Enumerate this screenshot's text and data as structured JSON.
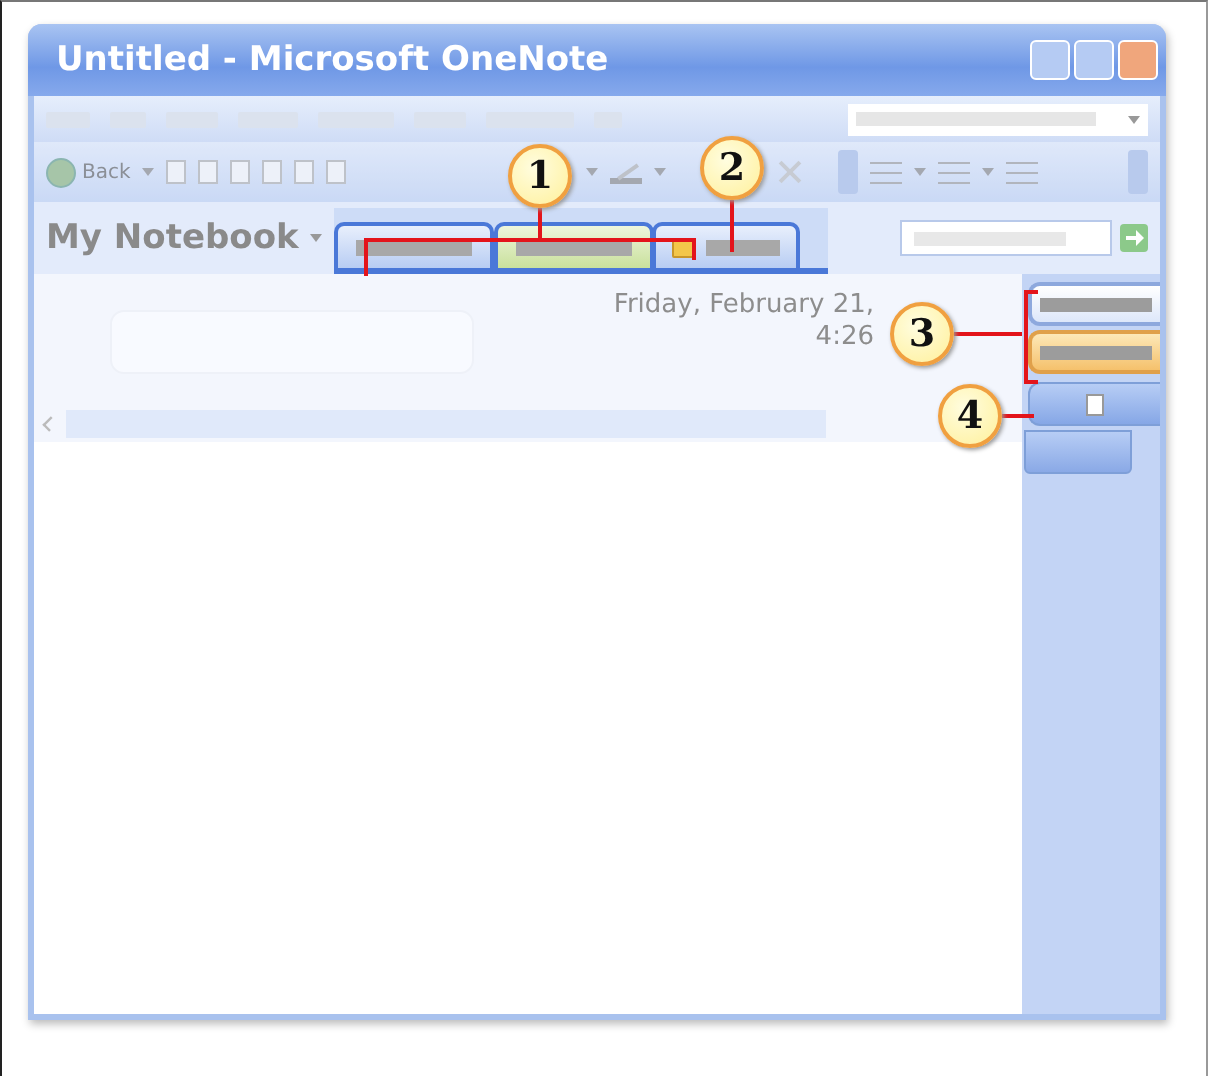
{
  "window": {
    "title": "Untitled - Microsoft OneNote"
  },
  "toolbar": {
    "back_label": "Back"
  },
  "notebook": {
    "name": "My Notebook"
  },
  "section_tabs": [
    {
      "kind": "section",
      "selected": false
    },
    {
      "kind": "section",
      "selected": true
    },
    {
      "kind": "folder",
      "selected": false
    }
  ],
  "page": {
    "date": "Friday, February 21,",
    "time": "4:26"
  },
  "page_tabs": [
    {
      "selected": false
    },
    {
      "selected": true
    }
  ],
  "callouts": [
    {
      "number": "1"
    },
    {
      "number": "2"
    },
    {
      "number": "3"
    },
    {
      "number": "4"
    }
  ]
}
